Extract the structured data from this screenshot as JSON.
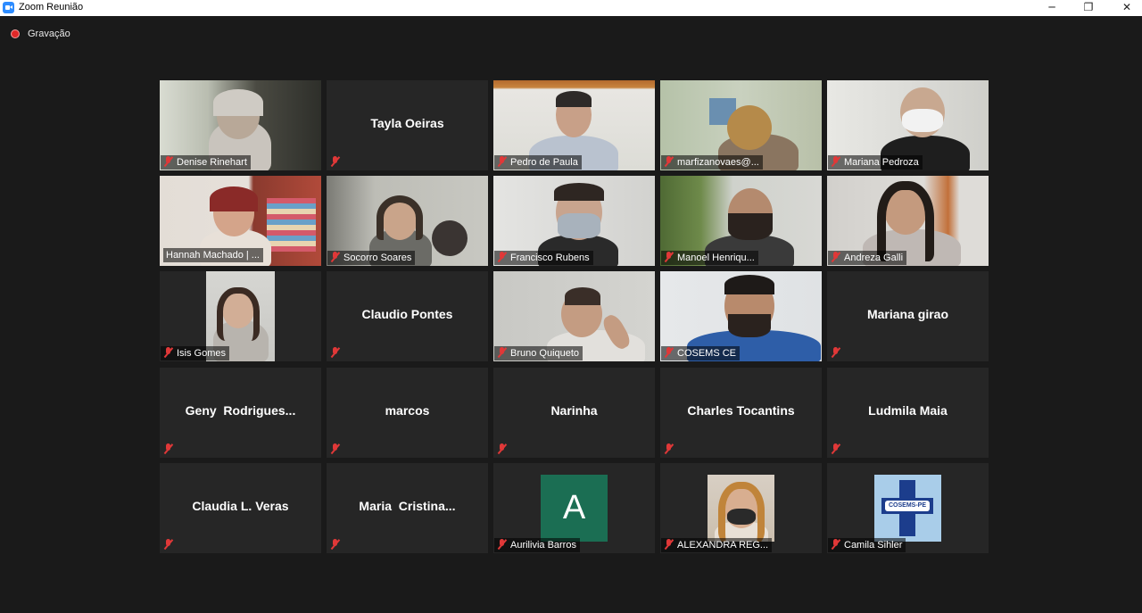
{
  "window": {
    "title": "Zoom Reunião",
    "minimize": "─",
    "restore": "❐",
    "close": "✕"
  },
  "recording": {
    "label": "Gravação"
  },
  "participants": [
    {
      "name": "Denise Rinehart",
      "video": true,
      "muted": true
    },
    {
      "name": "Tayla Oeiras",
      "display_name": "Tayla Oeiras",
      "video": false,
      "muted": true
    },
    {
      "name": "Pedro de Paula",
      "video": true,
      "muted": true
    },
    {
      "name": "marfizanovaes@...",
      "video": true,
      "muted": true
    },
    {
      "name": "Mariana Pedroza",
      "video": true,
      "muted": true
    },
    {
      "name": "Hannah Machado | ...",
      "video": true,
      "muted": false,
      "active_speaker": true
    },
    {
      "name": "Socorro Soares",
      "video": true,
      "muted": true
    },
    {
      "name": "Francisco Rubens",
      "video": true,
      "muted": true
    },
    {
      "name": "Manoel Henriqu...",
      "video": true,
      "muted": true
    },
    {
      "name": "Andreza Galli",
      "video": true,
      "muted": true
    },
    {
      "name": "Isis Gomes",
      "video": true,
      "muted": true
    },
    {
      "name": "Claudio Pontes",
      "display_name": "Claudio Pontes",
      "video": false,
      "muted": true
    },
    {
      "name": "Bruno Quiqueto",
      "video": true,
      "muted": true
    },
    {
      "name": "COSEMS CE",
      "video": true,
      "muted": true
    },
    {
      "name": "Mariana girao",
      "display_name": "Mariana girao",
      "video": false,
      "muted": true
    },
    {
      "name": "Geny Rodrigues...",
      "display_name": "Geny  Rodrigues...",
      "video": false,
      "muted": true
    },
    {
      "name": "marcos",
      "display_name": "marcos",
      "video": false,
      "muted": true
    },
    {
      "name": "Narinha",
      "display_name": "Narinha",
      "video": false,
      "muted": true
    },
    {
      "name": "Charles Tocantins",
      "display_name": "Charles Tocantins",
      "video": false,
      "muted": true
    },
    {
      "name": "Ludmila Maia",
      "display_name": "Ludmila Maia",
      "video": false,
      "muted": true
    },
    {
      "name": "Claudia L. Veras",
      "display_name": "Claudia L. Veras",
      "video": false,
      "muted": true
    },
    {
      "name": "Maria Cristina...",
      "display_name": "Maria  Cristina...",
      "video": false,
      "muted": true
    },
    {
      "name": "Aurilivia Barros",
      "video": false,
      "muted": true,
      "avatar_letter": "A",
      "avatar_color": "#1b6e53"
    },
    {
      "name": "ALEXANDRA REG...",
      "video": false,
      "muted": true,
      "avatar": "profile-photo"
    },
    {
      "name": "Camila Sihler",
      "video": false,
      "muted": true,
      "avatar": "cosems-pe-logo",
      "logo_text": "COSEMS-PE"
    }
  ],
  "colors": {
    "background": "#1a1a1a",
    "tile": "#262626",
    "active_speaker_border": "#e4e64a",
    "muted_icon": "#e03838"
  }
}
